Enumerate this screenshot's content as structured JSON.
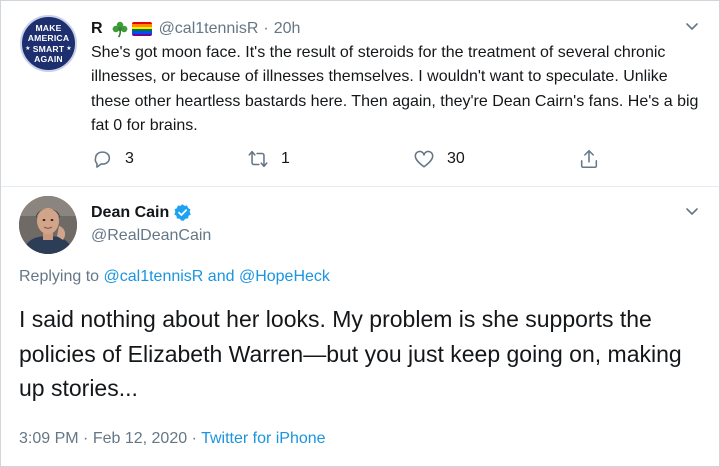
{
  "reply_tweet": {
    "avatar_lines": [
      "MAKE",
      "AMERICA",
      "SMART",
      "AGAIN"
    ],
    "display_name": "R",
    "emoji_icons": [
      "shamrock-icon",
      "rainbow-flag-icon"
    ],
    "handle": "@cal1tennisR",
    "separator": "·",
    "time": "20h",
    "text": "She's got moon face. It's the result of steroids for the treatment of several chronic illnesses, or because of illnesses themselves. I wouldn't want to speculate. Unlike these other heartless bastards here. Then again, they're Dean Cairn's fans. He's a big fat 0 for brains.",
    "actions": {
      "reply_count": "3",
      "retweet_count": "1",
      "like_count": "30"
    }
  },
  "main_tweet": {
    "display_name": "Dean Cain",
    "verified": true,
    "handle": "@RealDeanCain",
    "replying_prefix": "Replying to",
    "replying_to": [
      "@cal1tennisR",
      "@HopeHeck"
    ],
    "replying_joiner": "and",
    "text": "I said nothing about her looks.  My problem is she supports the policies of Elizabeth Warren—but you just keep going on, making up stories...",
    "time": "3:09 PM",
    "separator": "·",
    "date": "Feb 12, 2020",
    "source": "Twitter for iPhone"
  },
  "colors": {
    "text_primary": "#14171a",
    "text_secondary": "#657786",
    "link": "#1b95e0",
    "verified": "#1da1f2",
    "divider": "#e6ecf0",
    "badge_navy": "#1d2f6e"
  }
}
